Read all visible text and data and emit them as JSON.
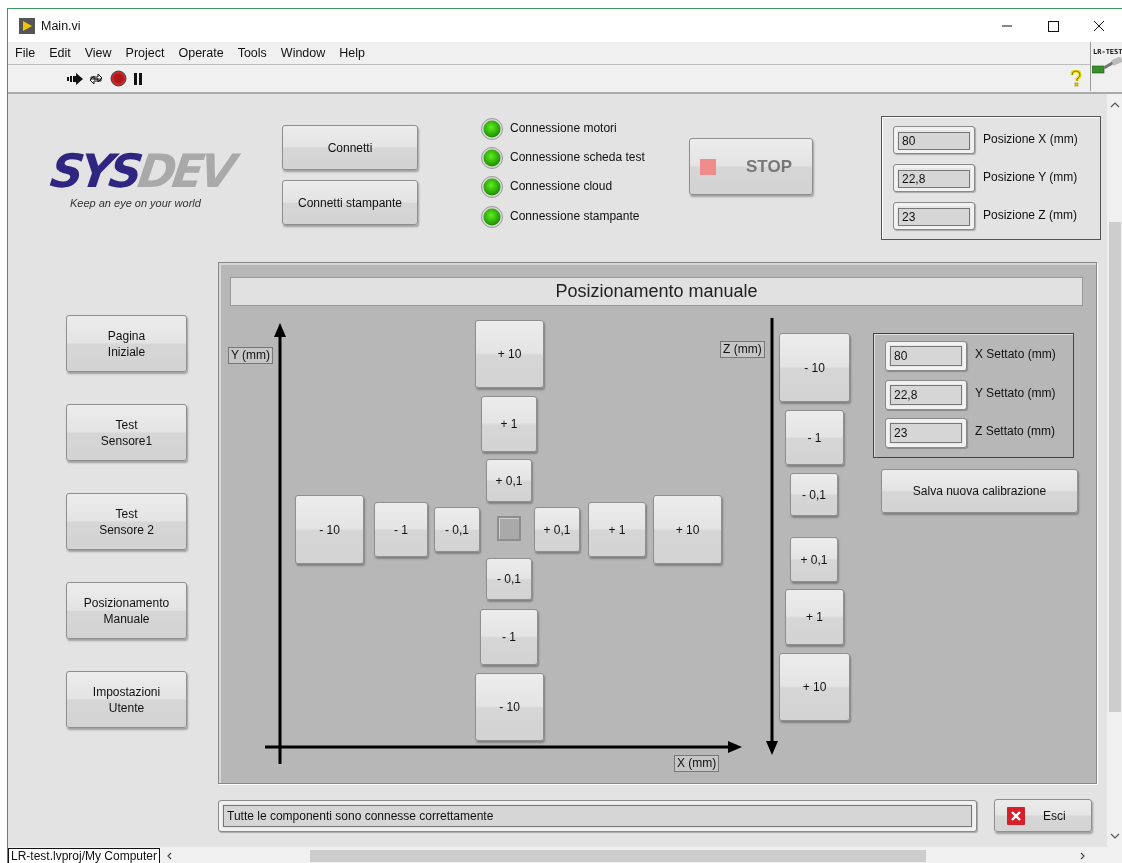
{
  "window": {
    "title": "Main.vi",
    "project_badge": "LR-TEST"
  },
  "menu": [
    "File",
    "Edit",
    "View",
    "Project",
    "Operate",
    "Tools",
    "Window",
    "Help"
  ],
  "logo": {
    "wordmark_dark": "SYS",
    "wordmark_light": "DEV",
    "tagline": "Keep an eye on your world"
  },
  "connect_buttons": [
    "Connetti",
    "Connetti stampante"
  ],
  "indicators": [
    {
      "label": "Connessione motori",
      "on": true
    },
    {
      "label": "Connessione scheda test",
      "on": true
    },
    {
      "label": "Connessione cloud",
      "on": true
    },
    {
      "label": "Connessione stampante",
      "on": true
    }
  ],
  "stop_button": {
    "label": "STOP"
  },
  "positions": [
    {
      "value": "80",
      "label": "Posizione X (mm)"
    },
    {
      "value": "22,8",
      "label": "Posizione Y (mm)"
    },
    {
      "value": "23",
      "label": "Posizione Z (mm)"
    }
  ],
  "nav_buttons": [
    "Pagina\nIniziale",
    "Test\nSensore1",
    "Test\nSensore 2",
    "Posizionamento\nManuale",
    "Impostazioni\nUtente"
  ],
  "manual": {
    "title": "Posizionamento manuale",
    "y_axis_label": "Y (mm)",
    "x_axis_label": "X (mm)",
    "z_axis_label": "Z (mm)",
    "y_jog": [
      "+ 10",
      "+ 1",
      "+ 0,1",
      "- 0,1",
      "- 1",
      "- 10"
    ],
    "x_jog": [
      "- 10",
      "- 1",
      "- 0,1",
      "+ 0,1",
      "+ 1",
      "+ 10"
    ],
    "z_jog": [
      "- 10",
      "- 1",
      "- 0,1",
      "+ 0,1",
      "+ 1",
      "+ 10"
    ],
    "setpoints": [
      {
        "value": "80",
        "label": "X Settato (mm)"
      },
      {
        "value": "22,8",
        "label": "Y Settato (mm)"
      },
      {
        "value": "23",
        "label": "Z Settato (mm)"
      }
    ],
    "save_button": "Salva nuova calibrazione"
  },
  "status_message": "Tutte le componenti sono connesse correttamente",
  "exit_button": "Esci",
  "status_bar": {
    "context": "LR-test.lvproj/My Computer"
  }
}
